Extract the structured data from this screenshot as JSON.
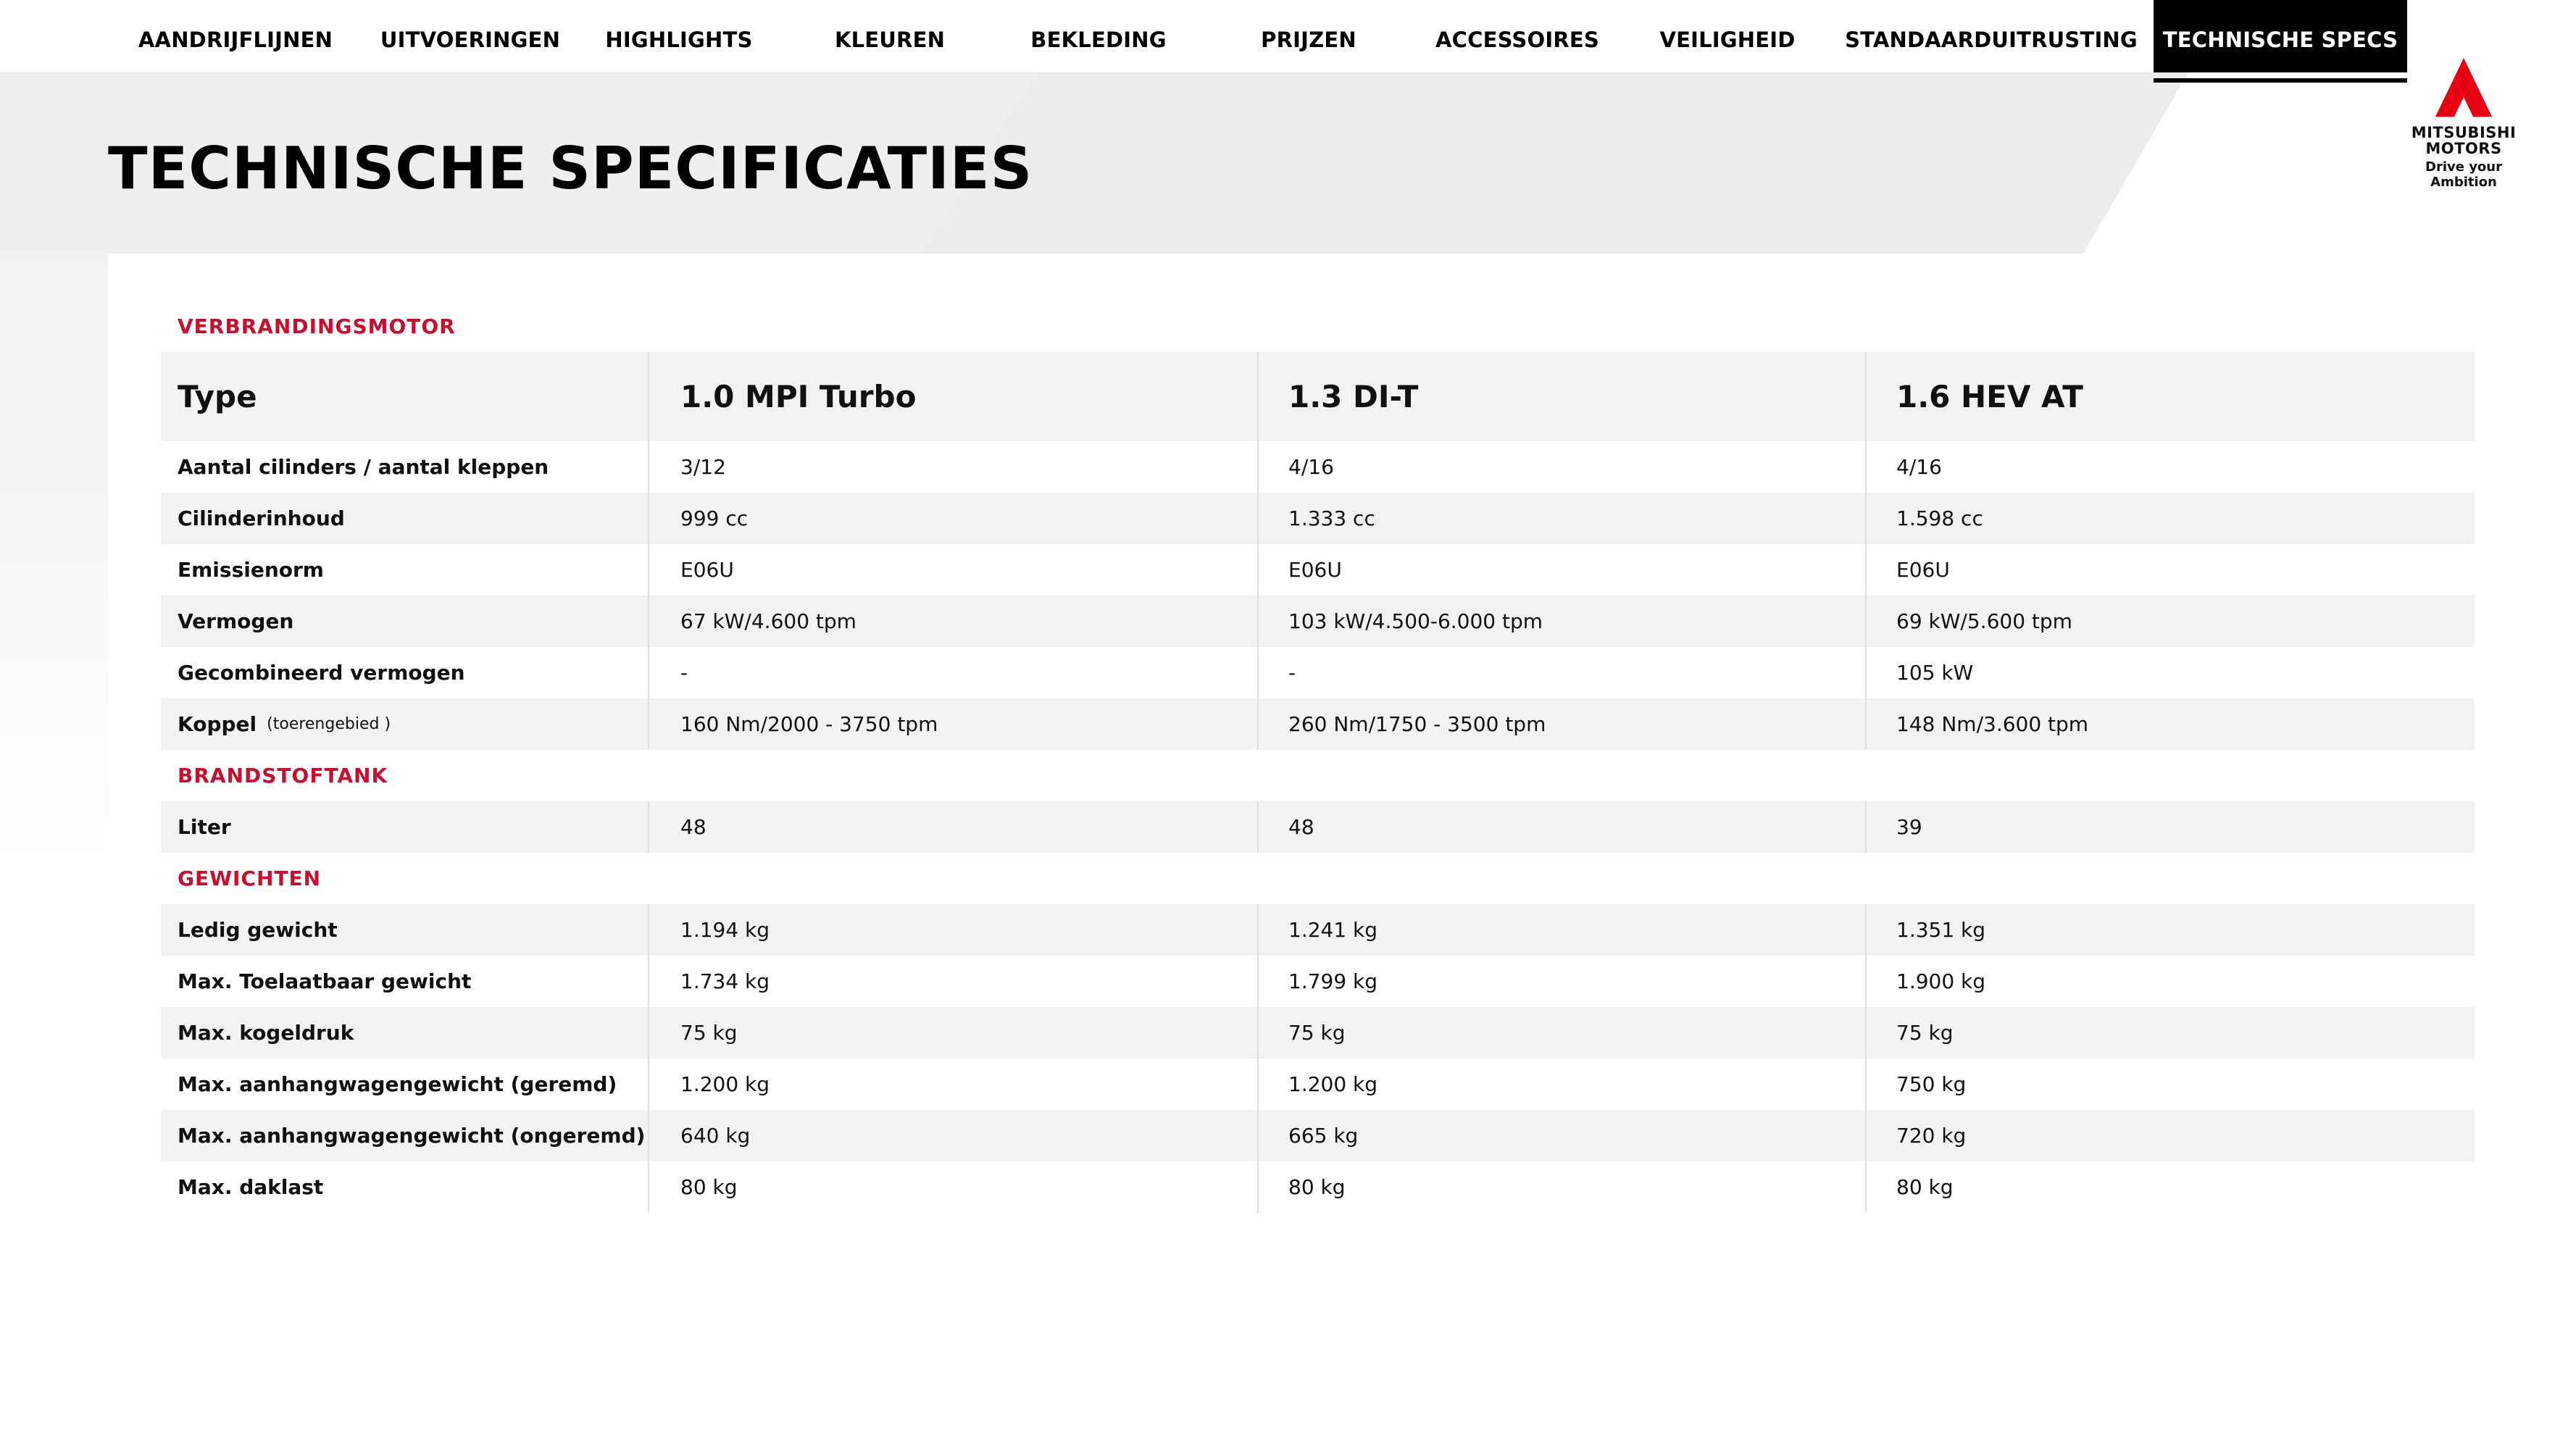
{
  "nav": {
    "items": [
      {
        "label": "AANDRIJFLIJNEN",
        "active": false
      },
      {
        "label": "UITVOERINGEN",
        "active": false
      },
      {
        "label": "HIGHLIGHTS",
        "active": false
      },
      {
        "label": "KLEUREN",
        "active": false
      },
      {
        "label": "BEKLEDING",
        "active": false
      },
      {
        "label": "PRIJZEN",
        "active": false
      },
      {
        "label": "ACCESSOIRES",
        "active": false
      },
      {
        "label": "VEILIGHEID",
        "active": false
      },
      {
        "label": "STANDAARDUITRUSTING",
        "active": false
      },
      {
        "label": "TECHNISCHE SPECS",
        "active": true
      }
    ]
  },
  "brand": {
    "name_line1": "MITSUBISHI",
    "name_line2": "MOTORS",
    "tagline": "Drive your Ambition",
    "logo_icon": "three-diamonds-icon",
    "color": "#e60012"
  },
  "page": {
    "title": "TECHNISCHE SPECIFICATIES"
  },
  "colors": {
    "section_red": "#c8102e",
    "row_shade": "#f2f2f2",
    "active_tab": "#000000"
  },
  "specs": {
    "header": {
      "label": "Type",
      "columns": [
        "1.0 MPI Turbo",
        "1.3 DI-T",
        "1.6 HEV AT"
      ]
    },
    "sections": [
      {
        "title": "VERBRANDINGSMOTOR",
        "rows": [
          {
            "label": "Aantal cilinders / aantal kleppen",
            "note": "",
            "values": [
              "3/12",
              "4/16",
              "4/16"
            ]
          },
          {
            "label": "Cilinderinhoud",
            "note": "",
            "values": [
              "999 cc",
              "1.333 cc",
              "1.598 cc"
            ]
          },
          {
            "label": "Emissienorm",
            "note": "",
            "values": [
              "E06U",
              "E06U",
              "E06U"
            ]
          },
          {
            "label": "Vermogen",
            "note": "",
            "values": [
              "67 kW/4.600 tpm",
              "103 kW/4.500-6.000 tpm",
              "69 kW/5.600 tpm"
            ]
          },
          {
            "label": "Gecombineerd vermogen",
            "note": "",
            "values": [
              "-",
              "-",
              "105 kW"
            ]
          },
          {
            "label": "Koppel",
            "note": "(toerengebied )",
            "values": [
              "160 Nm/2000 - 3750 tpm",
              "260 Nm/1750 - 3500 tpm",
              "148 Nm/3.600 tpm"
            ]
          }
        ]
      },
      {
        "title": "BRANDSTOFTANK",
        "rows": [
          {
            "label": "Liter",
            "note": "",
            "values": [
              "48",
              "48",
              "39"
            ]
          }
        ]
      },
      {
        "title": "GEWICHTEN",
        "rows": [
          {
            "label": "Ledig gewicht",
            "note": "",
            "values": [
              "1.194 kg",
              "1.241 kg",
              "1.351 kg"
            ]
          },
          {
            "label": "Max. Toelaatbaar gewicht",
            "note": "",
            "values": [
              "1.734 kg",
              "1.799 kg",
              "1.900 kg"
            ]
          },
          {
            "label": "Max. kogeldruk",
            "note": "",
            "values": [
              "75 kg",
              "75 kg",
              "75 kg"
            ]
          },
          {
            "label": "Max. aanhangwagengewicht (geremd)",
            "note": "",
            "values": [
              "1.200 kg",
              "1.200 kg",
              "750 kg"
            ]
          },
          {
            "label": "Max. aanhangwagengewicht (ongeremd)",
            "note": "",
            "values": [
              "640 kg",
              "665 kg",
              "720 kg"
            ]
          },
          {
            "label": "Max. daklast",
            "note": "",
            "values": [
              "80 kg",
              "80 kg",
              "80 kg"
            ]
          }
        ]
      }
    ]
  }
}
